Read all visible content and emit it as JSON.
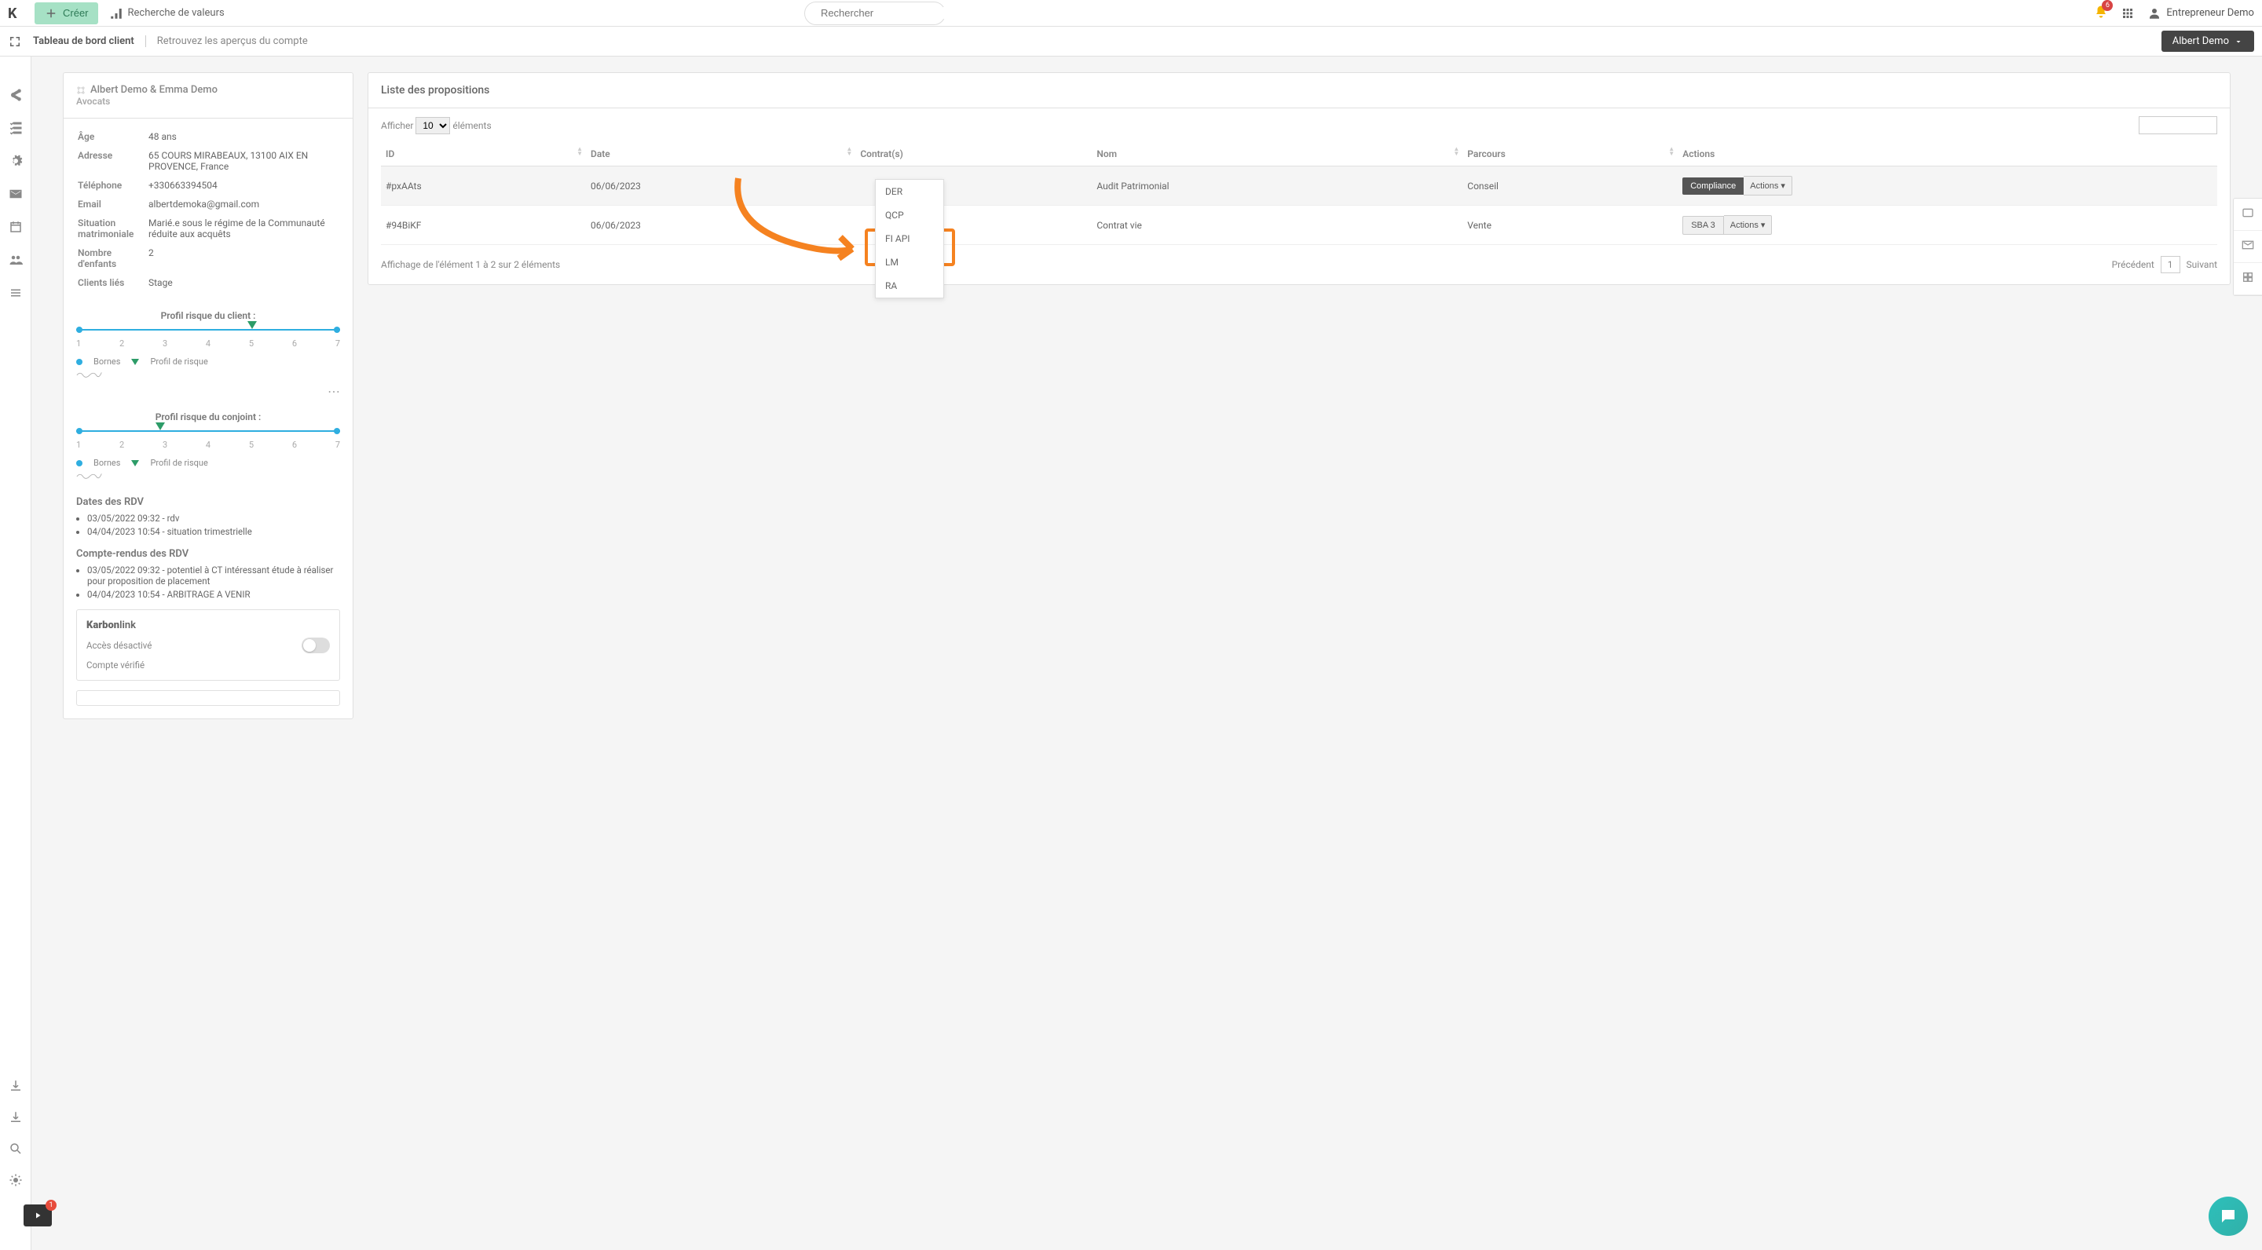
{
  "top": {
    "create": "Créer",
    "research": "Recherche de valeurs",
    "search_placeholder": "Rechercher",
    "notif_count": "6",
    "user_name": "Entrepreneur Demo"
  },
  "subbar": {
    "title": "Tableau de bord client",
    "subtitle": "Retrouvez les aperçus du compte",
    "user_button": "Albert Demo"
  },
  "client": {
    "name_line": "Albert Demo & Emma Demo",
    "job": "Avocats",
    "fields": {
      "age_label": "Âge",
      "age": "48 ans",
      "addr_label": "Adresse",
      "addr": "65 COURS MIRABEAUX, 13100 AIX EN PROVENCE, France",
      "tel_label": "Téléphone",
      "tel": "+330663394504",
      "email_label": "Email",
      "email": "albertdemoka@gmail.com",
      "situ_label": "Situation matrimoniale",
      "situ": "Marié.e sous le régime de la Communauté réduite aux acquêts",
      "kids_label": "Nombre d'enfants",
      "kids": "2",
      "linked_label": "Clients liés",
      "linked": "Stage"
    },
    "risk_client_title": "Profil risque du client :",
    "risk_spouse_title": "Profil risque du conjoint :",
    "scale": [
      "1",
      "2",
      "3",
      "4",
      "5",
      "6",
      "7"
    ],
    "legend_bornes": "Bornes",
    "legend_profil": "Profil de risque",
    "client_marker_pct": 65,
    "spouse_marker_pct": 30,
    "rdv_heading": "Dates des RDV",
    "rdv_list": [
      "03/05/2022 09:32 - rdv",
      "04/04/2023 10:54 - situation trimestrielle"
    ],
    "cr_heading": "Compte-rendus des RDV",
    "cr_list": [
      "03/05/2022 09:32 - potentiel à CT intéressant étude à réaliser pour proposition de placement",
      "04/04/2023 10:54 - ARBITRAGE A VENIR"
    ],
    "karbon_title_a": "Karbon",
    "karbon_title_b": "link",
    "access_label": "Accès désactivé",
    "verified_label": "Compte vérifié"
  },
  "proposals": {
    "header": "Liste des propositions",
    "show_label": "Afficher",
    "show_value": "10",
    "elements_label": "éléments",
    "cols": {
      "id": "ID",
      "date": "Date",
      "contrats": "Contrat(s)",
      "nom": "Nom",
      "parcours": "Parcours",
      "actions": "Actions"
    },
    "rows": [
      {
        "id": "#pxAAts",
        "date": "06/06/2023",
        "contrat": "",
        "nom": "Audit Patrimonial",
        "parcours": "Conseil",
        "btn1": "Compliance",
        "btn2": "Actions"
      },
      {
        "id": "#94BiKF",
        "date": "06/06/2023",
        "contrat": "",
        "nom": "Contrat vie",
        "parcours": "Vente",
        "btn1": "SBA 3",
        "btn2": "Actions"
      }
    ],
    "footer_info": "Affichage de l'élément 1 à 2 sur 2 éléments",
    "prev": "Précédent",
    "page": "1",
    "next": "Suivant"
  },
  "dropdown": {
    "items": [
      "DER",
      "QCP",
      "FI API",
      "LM",
      "RA"
    ]
  },
  "video_badge": "1"
}
